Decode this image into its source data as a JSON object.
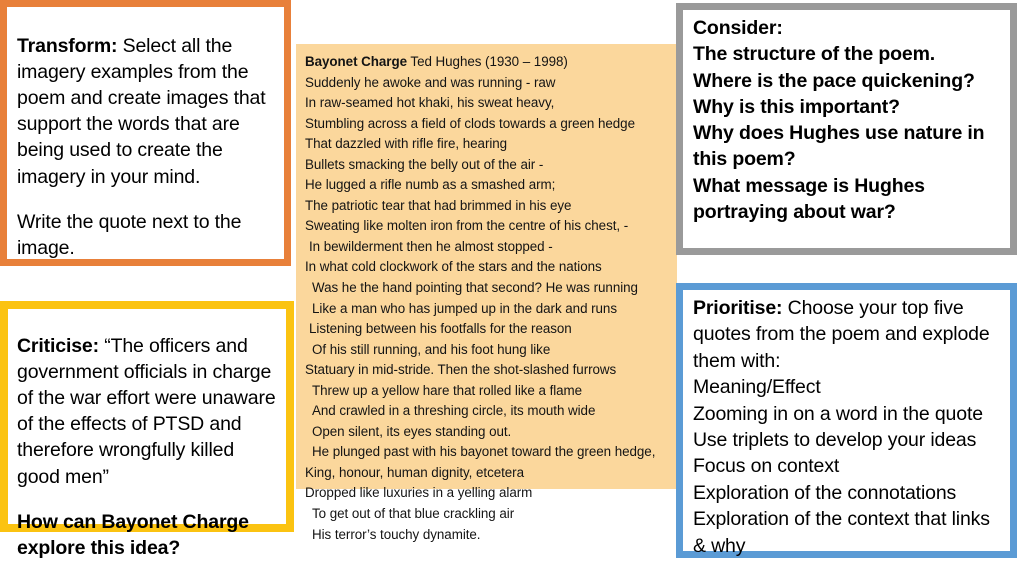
{
  "slide": {
    "background_color": "#ffffff",
    "boxes": {
      "transform": {
        "border_color": "#e8803a",
        "title": "Transform:",
        "body": " Select all the imagery examples from the poem and create images that support the words that are being used to create the imagery in your mind.",
        "body2": "Write the quote next to the image."
      },
      "criticise": {
        "border_color": "#fbc311",
        "title": "Criticise:",
        "quote": " “The officers and government officials in charge of the war effort were unaware of the effects of PTSD and therefore wrongfully killed good men”",
        "question": "How can Bayonet Charge explore this idea?"
      },
      "consider": {
        "border_color": "#9a9a9a",
        "lines": [
          "Consider:",
          "The structure of the poem.",
          "Where is the pace quickening?",
          "Why is this important?",
          "Why does Hughes use nature in this poem?",
          "What message is Hughes portraying about war?"
        ]
      },
      "prioritise": {
        "border_color": "#5b9bd5",
        "title": "Prioritise:",
        "intro": " Choose your top five quotes from the poem and explode them with:",
        "items": [
          "Meaning/Effect",
          "Zooming in on a word in the quote",
          "Use triplets to develop your ideas",
          "Focus on context",
          "Exploration of the connotations",
          "Exploration of the context that links & why"
        ]
      },
      "poem": {
        "background_color": "#fbd79c",
        "title": "Bayonet Charge",
        "attribution": " Ted Hughes (1930 – 1998)",
        "lines": [
          {
            "text": "Suddenly he awoke and was running - raw",
            "indent": 0
          },
          {
            "text": "In raw-seamed hot khaki, his sweat heavy,",
            "indent": 0
          },
          {
            "text": "Stumbling across a field of clods towards a green hedge",
            "indent": 0
          },
          {
            "text": "That dazzled with rifle fire, hearing",
            "indent": 0
          },
          {
            "text": "Bullets smacking the belly out of the air -",
            "indent": 0
          },
          {
            "text": "He lugged a rifle numb as a smashed arm;",
            "indent": 0
          },
          {
            "text": "The patriotic tear that had brimmed in his eye",
            "indent": 0
          },
          {
            "text": "Sweating like molten iron from the centre of his chest, -",
            "indent": 0
          },
          {
            "text": "In bewilderment then he almost stopped -",
            "indent": 1
          },
          {
            "text": "In what cold clockwork of the stars and the nations",
            "indent": 0
          },
          {
            "text": "Was he the hand pointing that second? He was running",
            "indent": 2
          },
          {
            "text": "Like a man who has jumped up in the dark and runs",
            "indent": 2
          },
          {
            "text": "Listening between his footfalls for the reason",
            "indent": 1
          },
          {
            "text": "Of his still running, and his foot hung like",
            "indent": 2
          },
          {
            "text": "Statuary in mid-stride. Then the shot-slashed furrows",
            "indent": 0
          },
          {
            "text": "Threw up a yellow hare that rolled like a flame",
            "indent": 2
          },
          {
            "text": "And crawled in a threshing circle, its mouth wide",
            "indent": 2
          },
          {
            "text": "Open silent, its eyes standing out.",
            "indent": 2
          },
          {
            "text": "He plunged past with his bayonet toward the green hedge,",
            "indent": 2
          },
          {
            "text": "King, honour, human dignity, etcetera",
            "indent": 0
          },
          {
            "text": "Dropped like luxuries in a yelling alarm",
            "indent": 0
          },
          {
            "text": "To get out of that blue crackling air",
            "indent": 2
          },
          {
            "text": "His terror’s touchy dynamite.",
            "indent": 2
          }
        ]
      }
    }
  }
}
